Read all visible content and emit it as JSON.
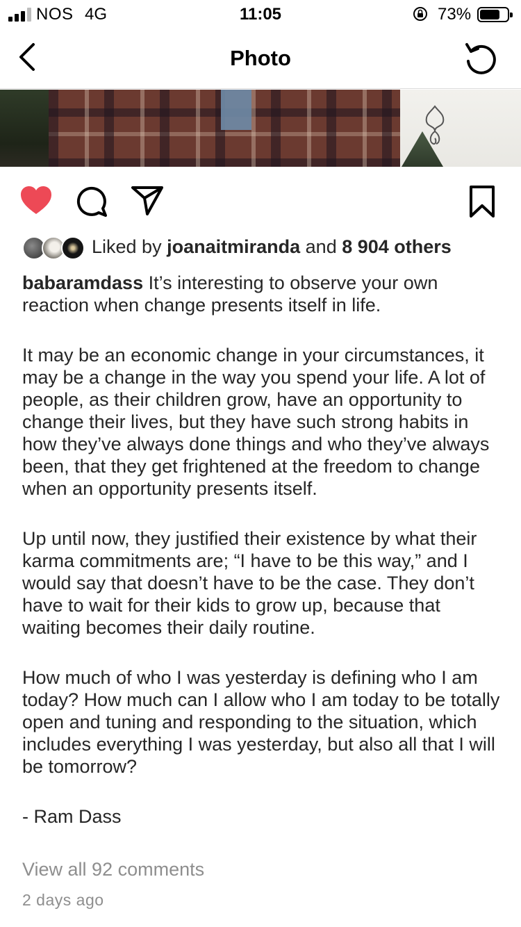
{
  "status_bar": {
    "carrier": "NOS",
    "network": "4G",
    "time": "11:05",
    "battery_percent": "73%",
    "battery_level": 0.73,
    "signal_bars": 3,
    "signal_bars_total": 4
  },
  "nav": {
    "title": "Photo",
    "back_icon": "chevron-left-icon",
    "refresh_icon": "refresh-icon"
  },
  "actions": {
    "liked": true,
    "like_color": "#ed4956",
    "icons": [
      "heart-icon",
      "comment-icon",
      "share-icon",
      "bookmark-icon"
    ]
  },
  "likes": {
    "prefix": "Liked by",
    "user": "joanaitmiranda",
    "and": "and",
    "others": "8 904 others"
  },
  "caption": {
    "username": "babaramdass",
    "paragraphs": [
      "It’s interesting to observe your own reaction when change presents itself in life.",
      "It may be an economic change in your circumstances, it may be a change in the way you spend your life. A lot of people, as their children grow, have an opportunity to change their lives, but they have such strong habits in how they’ve always done things and who they’ve always been, that they get frightened at the freedom to change when an opportunity presents itself.",
      "Up until now, they justified their existence by what their karma commitments are; “I have to be this way,” and I would say that doesn’t have to be the case. They don’t have to wait for their kids to grow up, because that waiting becomes their daily routine.",
      "How much of who I was yesterday is defining who I am today? How much can I allow who I am today to be totally open and tuning and responding to the situation, which includes everything I was yesterday, but also all that I will be tomorrow?",
      "- Ram Dass"
    ]
  },
  "comments": {
    "view_all": "View all 92 comments"
  },
  "timestamp": "2 days ago"
}
